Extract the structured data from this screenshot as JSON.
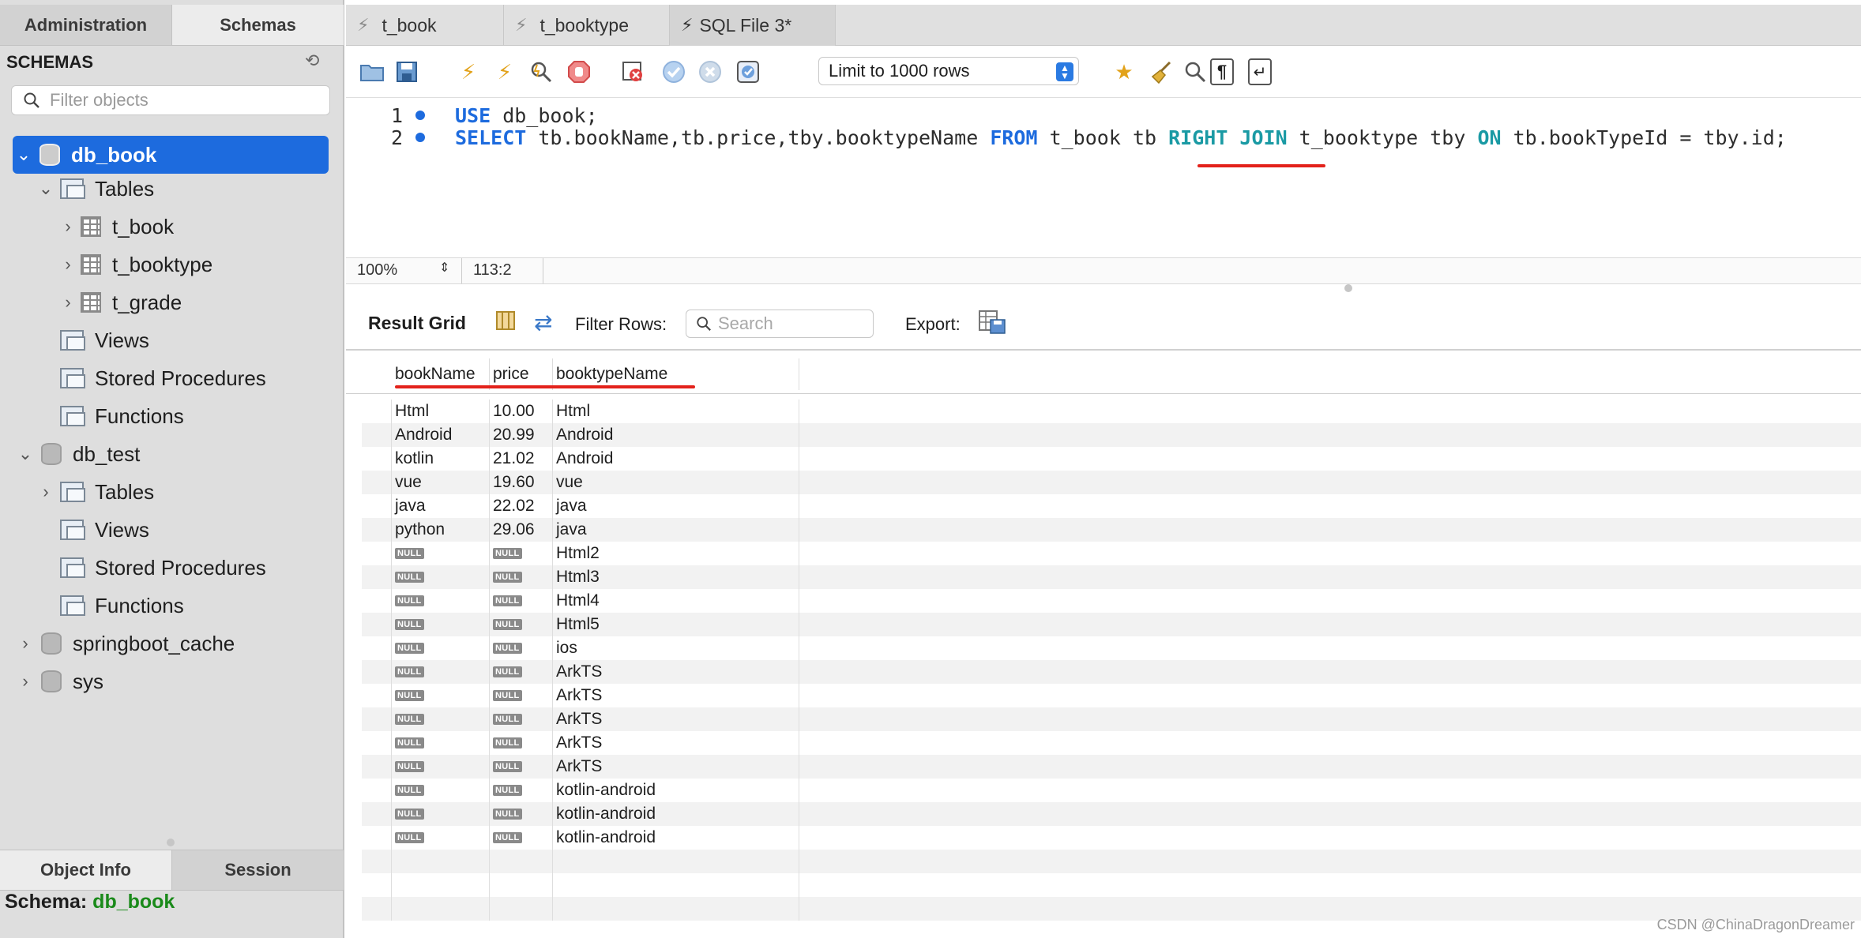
{
  "sidebar": {
    "tabs": [
      "Administration",
      "Schemas"
    ],
    "heading": "SCHEMAS",
    "filter_placeholder": "Filter objects",
    "tree": {
      "db_book": "db_book",
      "tables": "Tables",
      "t_book": "t_book",
      "t_booktype": "t_booktype",
      "t_grade": "t_grade",
      "views": "Views",
      "stored_procedures": "Stored Procedures",
      "functions": "Functions",
      "db_test": "db_test",
      "springboot_cache": "springboot_cache",
      "sys": "sys"
    },
    "bottom_tabs": [
      "Object Info",
      "Session"
    ],
    "schema_label": "Schema:",
    "schema_value": "db_book"
  },
  "editor": {
    "tabs": [
      "t_book",
      "t_booktype",
      "SQL File 3*"
    ],
    "limit_select": "Limit to 1000 rows",
    "lines": [
      {
        "num": "1"
      },
      {
        "num": "2"
      }
    ],
    "sql": {
      "use_kw": "USE",
      "use_rest": " db_book;",
      "select_kw": "SELECT",
      "select_cols": " tb.bookName,tb.price,tby.booktypeName ",
      "from_kw": "FROM",
      "from_rest": " t_book tb ",
      "join_kw": "RIGHT JOIN",
      "join_rest": " t_booktype tby ",
      "on_kw": "ON",
      "on_rest": " tb.bookTypeId = tby.id;"
    },
    "zoom": "100%",
    "cursor_pos": "113:2"
  },
  "result": {
    "label": "Result Grid",
    "filter_label": "Filter Rows:",
    "search_placeholder": "Search",
    "export_label": "Export:",
    "columns": [
      "bookName",
      "price",
      "booktypeName"
    ],
    "null_text": "NULL",
    "rows": [
      [
        "Html",
        "10.00",
        "Html"
      ],
      [
        "Android",
        "20.99",
        "Android"
      ],
      [
        "kotlin",
        "21.02",
        "Android"
      ],
      [
        "vue",
        "19.60",
        "vue"
      ],
      [
        "java",
        "22.02",
        "java"
      ],
      [
        "python",
        "29.06",
        "java"
      ],
      [
        null,
        null,
        "Html2"
      ],
      [
        null,
        null,
        "Html3"
      ],
      [
        null,
        null,
        "Html4"
      ],
      [
        null,
        null,
        "Html5"
      ],
      [
        null,
        null,
        "ios"
      ],
      [
        null,
        null,
        "ArkTS"
      ],
      [
        null,
        null,
        "ArkTS"
      ],
      [
        null,
        null,
        "ArkTS"
      ],
      [
        null,
        null,
        "ArkTS"
      ],
      [
        null,
        null,
        "ArkTS"
      ],
      [
        null,
        null,
        "kotlin-android"
      ],
      [
        null,
        null,
        "kotlin-android"
      ],
      [
        null,
        null,
        "kotlin-android"
      ]
    ]
  },
  "watermark": "CSDN @ChinaDragonDreamer",
  "colors": {
    "selection": "#1d6bde",
    "keyword": "#1d6bde",
    "keyword_join": "#1a9aa4",
    "underline": "#e3221b",
    "schema_value": "#1a8a1a"
  }
}
